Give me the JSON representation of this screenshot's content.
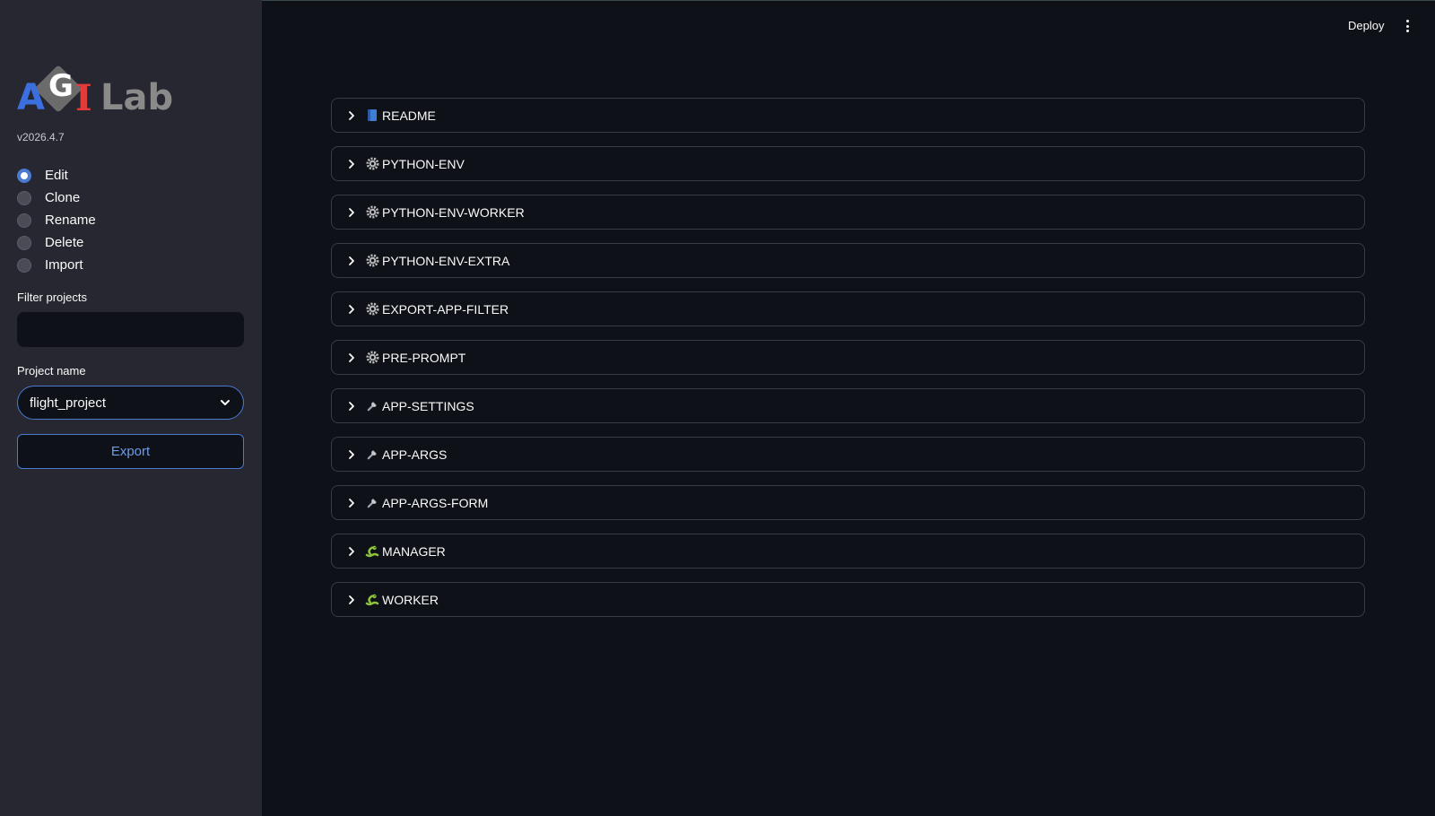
{
  "sidebar": {
    "logo": {
      "parts": [
        "A",
        "G",
        "I",
        "Lab"
      ]
    },
    "version": "v2026.4.7",
    "radio_options": [
      {
        "label": "Edit",
        "selected": true
      },
      {
        "label": "Clone",
        "selected": false
      },
      {
        "label": "Rename",
        "selected": false
      },
      {
        "label": "Delete",
        "selected": false
      },
      {
        "label": "Import",
        "selected": false
      }
    ],
    "filter_label": "Filter projects",
    "filter_value": "",
    "project_label": "Project name",
    "project_value": "flight_project",
    "export_label": "Export"
  },
  "header": {
    "deploy_label": "Deploy"
  },
  "expanders": [
    {
      "label": "README",
      "icon": "book-icon"
    },
    {
      "label": "PYTHON-ENV",
      "icon": "gear-icon"
    },
    {
      "label": "PYTHON-ENV-WORKER",
      "icon": "gear-icon"
    },
    {
      "label": "PYTHON-ENV-EXTRA",
      "icon": "gear-icon"
    },
    {
      "label": "EXPORT-APP-FILTER",
      "icon": "gear-icon"
    },
    {
      "label": "PRE-PROMPT",
      "icon": "gear-icon"
    },
    {
      "label": "APP-SETTINGS",
      "icon": "wrench-icon"
    },
    {
      "label": "APP-ARGS",
      "icon": "wrench-icon"
    },
    {
      "label": "APP-ARGS-FORM",
      "icon": "wrench-icon"
    },
    {
      "label": "MANAGER",
      "icon": "snake-icon"
    },
    {
      "label": "WORKER",
      "icon": "snake-icon"
    }
  ],
  "colors": {
    "accent": "#4a7bd0",
    "sidebar_bg": "#262730",
    "main_bg": "#0e1117"
  }
}
